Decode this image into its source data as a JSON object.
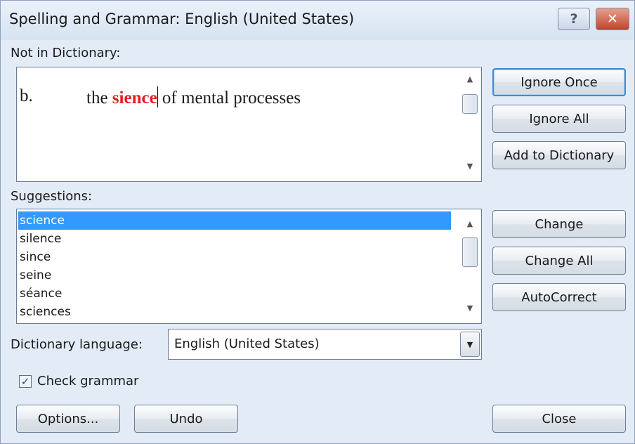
{
  "window": {
    "title": "Spelling and Grammar: English (United States)",
    "help_glyph": "?",
    "close_glyph": "✕"
  },
  "not_in_dictionary": {
    "label": "Not in Dictionary:",
    "list_number": "b.",
    "text_before": "the ",
    "error_word": "sience",
    "text_after": " of mental processes",
    "error_color": "#e02020"
  },
  "buttons": {
    "ignore_once": "Ignore Once",
    "ignore_all": "Ignore All",
    "add_to_dictionary": "Add to Dictionary",
    "change": "Change",
    "change_all": "Change All",
    "autocorrect": "AutoCorrect",
    "options": "Options...",
    "undo": "Undo",
    "close": "Close"
  },
  "suggestions": {
    "label": "Suggestions:",
    "items": [
      "science",
      "silence",
      "since",
      "seine",
      "séance",
      "sciences"
    ],
    "selected_index": 0,
    "selection_color": "#3399ff"
  },
  "dictionary_language": {
    "label": "Dictionary language:",
    "value": "English (United States)"
  },
  "check_grammar": {
    "label": "Check grammar",
    "checked": true
  }
}
